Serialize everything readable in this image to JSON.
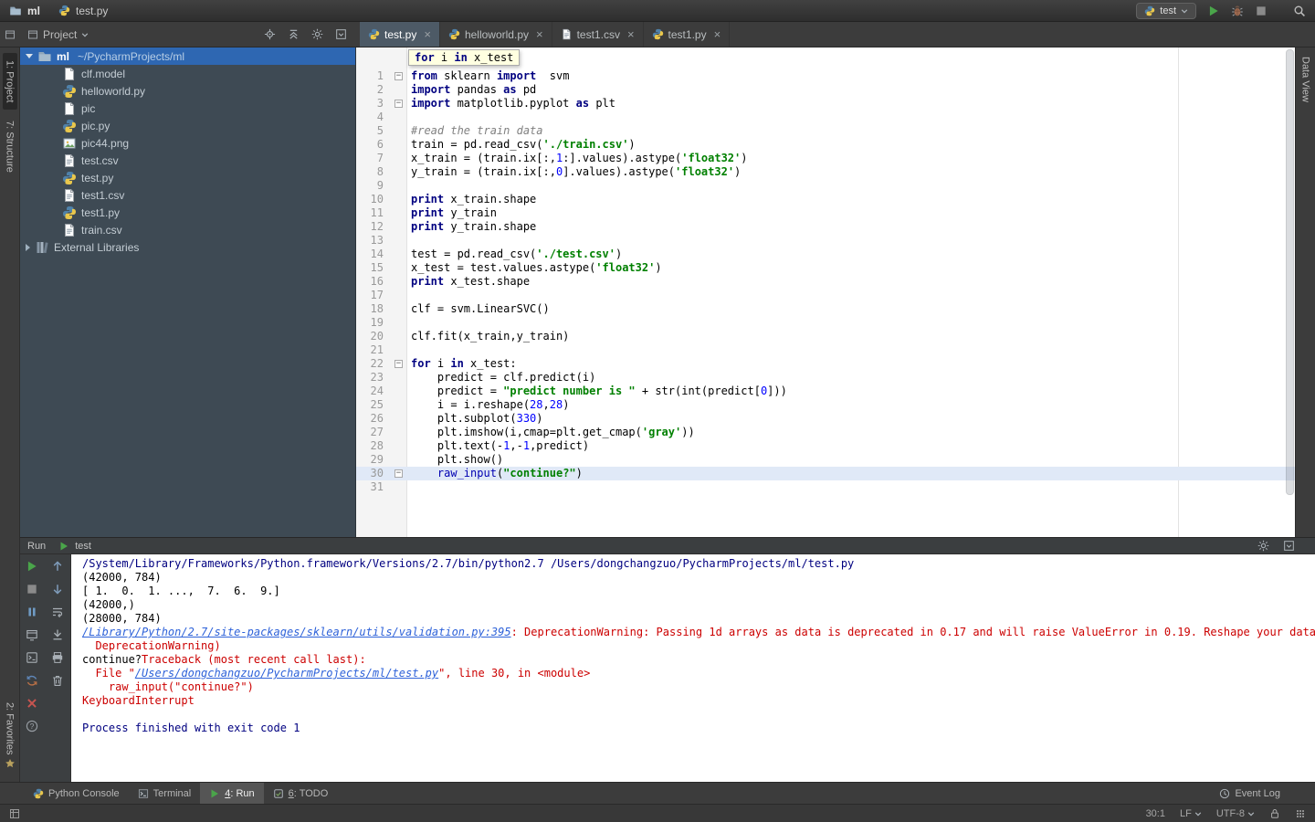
{
  "titlebar": {
    "project_label": "ml",
    "file_label": "test.py",
    "run_config_label": "test",
    "actions": [
      {
        "name": "run-button",
        "icon": "play-icon"
      },
      {
        "name": "debug-button",
        "icon": "debug-icon"
      },
      {
        "name": "stop-button",
        "icon": "stop-icon"
      },
      {
        "name": "search-everywhere-button",
        "icon": "search-icon"
      }
    ]
  },
  "tool_strips": {
    "left_top": [
      {
        "label": "1: Project",
        "active": true
      },
      {
        "label": "7: Structure",
        "active": false
      }
    ],
    "left_bottom": [
      {
        "label": "2: Favorites",
        "icon": "star-icon",
        "active": false
      }
    ],
    "right_top": [
      {
        "label": "Data View",
        "active": false
      }
    ]
  },
  "project_panel": {
    "header_title": "Project",
    "header_actions": [
      {
        "name": "locate-button",
        "icon": "locate-icon"
      },
      {
        "name": "collapse-all-button",
        "icon": "collapse-all-icon"
      },
      {
        "name": "settings-button",
        "icon": "gear-icon"
      },
      {
        "name": "hide-panel-button",
        "icon": "hide-icon"
      }
    ],
    "root_label": "ml",
    "root_path": "~/PycharmProjects/ml",
    "items": [
      {
        "label": "clf.model",
        "icon": "file-icon"
      },
      {
        "label": "helloworld.py",
        "icon": "python-file-icon"
      },
      {
        "label": "pic",
        "icon": "file-icon"
      },
      {
        "label": "pic.py",
        "icon": "python-file-icon"
      },
      {
        "label": "pic44.png",
        "icon": "image-file-icon"
      },
      {
        "label": "test.csv",
        "icon": "text-file-icon"
      },
      {
        "label": "test.py",
        "icon": "python-file-icon"
      },
      {
        "label": "test1.csv",
        "icon": "text-file-icon"
      },
      {
        "label": "test1.py",
        "icon": "python-file-icon"
      },
      {
        "label": "train.csv",
        "icon": "text-file-icon"
      }
    ],
    "external_libraries_label": "External Libraries"
  },
  "editor_tabs": [
    {
      "label": "test.py",
      "icon": "python-file-icon",
      "active": true
    },
    {
      "label": "helloworld.py",
      "icon": "python-file-icon",
      "active": false
    },
    {
      "label": "test1.csv",
      "icon": "text-file-icon",
      "active": false
    },
    {
      "label": "test1.py",
      "icon": "python-file-icon",
      "active": false
    }
  ],
  "editor": {
    "context_hint": [
      {
        "c": "k",
        "t": "for"
      },
      {
        "c": "p",
        "t": " i "
      },
      {
        "c": "k",
        "t": "in"
      },
      {
        "c": "p",
        "t": " x_test"
      }
    ],
    "fold_lines": [
      1,
      3,
      22,
      30
    ],
    "current_line": 30,
    "lines": [
      {
        "n": 1,
        "segs": [
          {
            "c": "k",
            "t": "from"
          },
          {
            "c": "p",
            "t": " sklearn "
          },
          {
            "c": "k",
            "t": "import"
          },
          {
            "c": "p",
            "t": "  svm"
          }
        ]
      },
      {
        "n": 2,
        "segs": [
          {
            "c": "k",
            "t": "import"
          },
          {
            "c": "p",
            "t": " pandas "
          },
          {
            "c": "k",
            "t": "as"
          },
          {
            "c": "p",
            "t": " pd"
          }
        ]
      },
      {
        "n": 3,
        "segs": [
          {
            "c": "k",
            "t": "import"
          },
          {
            "c": "p",
            "t": " matplotlib.pyplot "
          },
          {
            "c": "k",
            "t": "as"
          },
          {
            "c": "p",
            "t": " plt"
          }
        ]
      },
      {
        "n": 4,
        "segs": []
      },
      {
        "n": 5,
        "segs": [
          {
            "c": "c",
            "t": "#read the train data"
          }
        ]
      },
      {
        "n": 6,
        "segs": [
          {
            "c": "p",
            "t": "train = pd.read_csv("
          },
          {
            "c": "s",
            "t": "'./train.csv'"
          },
          {
            "c": "p",
            "t": ")"
          }
        ]
      },
      {
        "n": 7,
        "segs": [
          {
            "c": "p",
            "t": "x_train = (train.ix[:,"
          },
          {
            "c": "n",
            "t": "1"
          },
          {
            "c": "p",
            "t": ":].values).astype("
          },
          {
            "c": "s",
            "t": "'float32'"
          },
          {
            "c": "p",
            "t": ")"
          }
        ]
      },
      {
        "n": 8,
        "segs": [
          {
            "c": "p",
            "t": "y_train = (train.ix[:,"
          },
          {
            "c": "n",
            "t": "0"
          },
          {
            "c": "p",
            "t": "].values).astype("
          },
          {
            "c": "s",
            "t": "'float32'"
          },
          {
            "c": "p",
            "t": ")"
          }
        ]
      },
      {
        "n": 9,
        "segs": []
      },
      {
        "n": 10,
        "segs": [
          {
            "c": "k",
            "t": "print"
          },
          {
            "c": "p",
            "t": " x_train.shape"
          }
        ]
      },
      {
        "n": 11,
        "segs": [
          {
            "c": "k",
            "t": "print"
          },
          {
            "c": "p",
            "t": " y_train"
          }
        ]
      },
      {
        "n": 12,
        "segs": [
          {
            "c": "k",
            "t": "print"
          },
          {
            "c": "p",
            "t": " y_train.shape"
          }
        ]
      },
      {
        "n": 13,
        "segs": []
      },
      {
        "n": 14,
        "segs": [
          {
            "c": "p",
            "t": "test = pd.read_csv("
          },
          {
            "c": "s",
            "t": "'./test.csv'"
          },
          {
            "c": "p",
            "t": ")"
          }
        ]
      },
      {
        "n": 15,
        "segs": [
          {
            "c": "p",
            "t": "x_test = test.values.astype("
          },
          {
            "c": "s",
            "t": "'float32'"
          },
          {
            "c": "p",
            "t": ")"
          }
        ]
      },
      {
        "n": 16,
        "segs": [
          {
            "c": "k",
            "t": "print"
          },
          {
            "c": "p",
            "t": " x_test.shape"
          }
        ]
      },
      {
        "n": 17,
        "segs": []
      },
      {
        "n": 18,
        "segs": [
          {
            "c": "p",
            "t": "clf = svm.LinearSVC()"
          }
        ]
      },
      {
        "n": 19,
        "segs": []
      },
      {
        "n": 20,
        "segs": [
          {
            "c": "p",
            "t": "clf.fit(x_train,y_train)"
          }
        ]
      },
      {
        "n": 21,
        "segs": []
      },
      {
        "n": 22,
        "segs": [
          {
            "c": "k",
            "t": "for"
          },
          {
            "c": "p",
            "t": " i "
          },
          {
            "c": "k",
            "t": "in"
          },
          {
            "c": "p",
            "t": " x_test:"
          }
        ]
      },
      {
        "n": 23,
        "segs": [
          {
            "c": "p",
            "t": "    predict = clf.predict(i)"
          }
        ]
      },
      {
        "n": 24,
        "segs": [
          {
            "c": "p",
            "t": "    predict = "
          },
          {
            "c": "s",
            "t": "\"predict number is \""
          },
          {
            "c": "p",
            "t": " + str(int(predict["
          },
          {
            "c": "n",
            "t": "0"
          },
          {
            "c": "p",
            "t": "]))"
          }
        ]
      },
      {
        "n": 25,
        "segs": [
          {
            "c": "p",
            "t": "    i = i.reshape("
          },
          {
            "c": "n",
            "t": "28"
          },
          {
            "c": "p",
            "t": ","
          },
          {
            "c": "n",
            "t": "28"
          },
          {
            "c": "p",
            "t": ")"
          }
        ]
      },
      {
        "n": 26,
        "segs": [
          {
            "c": "p",
            "t": "    plt.subplot("
          },
          {
            "c": "n",
            "t": "330"
          },
          {
            "c": "p",
            "t": ")"
          }
        ]
      },
      {
        "n": 27,
        "segs": [
          {
            "c": "p",
            "t": "    plt.imshow(i,cmap=plt.get_cmap("
          },
          {
            "c": "s",
            "t": "'gray'"
          },
          {
            "c": "p",
            "t": "))"
          }
        ]
      },
      {
        "n": 28,
        "segs": [
          {
            "c": "p",
            "t": "    plt.text(-"
          },
          {
            "c": "n",
            "t": "1"
          },
          {
            "c": "p",
            "t": ",-"
          },
          {
            "c": "n",
            "t": "1"
          },
          {
            "c": "p",
            "t": ",predict)"
          }
        ]
      },
      {
        "n": 29,
        "segs": [
          {
            "c": "p",
            "t": "    plt.show()"
          }
        ]
      },
      {
        "n": 30,
        "segs": [
          {
            "c": "p",
            "t": "    "
          },
          {
            "c": "b",
            "t": "raw_input"
          },
          {
            "c": "p",
            "t": "("
          },
          {
            "c": "s",
            "t": "\"continue?\""
          },
          {
            "c": "p",
            "t": ")"
          }
        ]
      },
      {
        "n": 31,
        "segs": []
      }
    ]
  },
  "run_panel": {
    "title": "Run",
    "config_label": "test",
    "header_actions": [
      {
        "name": "settings-button",
        "icon": "gear-icon"
      },
      {
        "name": "hide-panel-button",
        "icon": "hide-icon"
      }
    ],
    "toolbar_main": [
      {
        "name": "rerun-button",
        "icon": "play-icon"
      },
      {
        "name": "stop-button",
        "icon": "stop-icon"
      },
      {
        "name": "pause-output-button",
        "icon": "pause-icon"
      },
      {
        "name": "restore-layout-button",
        "icon": "restore-layout-icon"
      },
      {
        "name": "show-console-button",
        "icon": "console-icon"
      },
      {
        "name": "rerun-failed-button",
        "icon": "refresh-icon"
      },
      {
        "name": "close-button",
        "icon": "close-icon"
      },
      {
        "name": "help-button",
        "icon": "help-icon"
      }
    ],
    "toolbar_secondary": [
      {
        "name": "up-stack-trace-button",
        "icon": "up-icon"
      },
      {
        "name": "down-stack-trace-button",
        "icon": "down-icon"
      },
      {
        "name": "soft-wrap-button",
        "icon": "soft-wrap-icon"
      },
      {
        "name": "scroll-to-end-button",
        "icon": "scroll-end-icon"
      },
      {
        "name": "print-button",
        "icon": "print-icon"
      },
      {
        "name": "clear-all-button",
        "icon": "trash-icon"
      }
    ],
    "console_lines": [
      {
        "segs": [
          {
            "c": "sys",
            "t": "/System/Library/Frameworks/Python.framework/Versions/2.7/bin/python2.7 /Users/dongchangzuo/PycharmProjects/ml/test.py"
          }
        ]
      },
      {
        "segs": [
          {
            "c": "out",
            "t": "(42000, 784)"
          }
        ]
      },
      {
        "segs": [
          {
            "c": "out",
            "t": "[ 1.  0.  1. ...,  7.  6.  9.]"
          }
        ]
      },
      {
        "segs": [
          {
            "c": "out",
            "t": "(42000,)"
          }
        ]
      },
      {
        "segs": [
          {
            "c": "out",
            "t": "(28000, 784)"
          }
        ]
      },
      {
        "segs": [
          {
            "c": "link",
            "t": "/Library/Python/2.7/site-packages/sklearn/utils/validation.py:395"
          },
          {
            "c": "err",
            "t": ": DeprecationWarning: Passing 1d arrays as data is deprecated in 0.17 and will raise ValueError in 0.19. Reshape your data ei"
          }
        ]
      },
      {
        "segs": [
          {
            "c": "err",
            "t": "  DeprecationWarning)"
          }
        ]
      },
      {
        "segs": [
          {
            "c": "out",
            "t": "continue?"
          },
          {
            "c": "err",
            "t": "Traceback (most recent call last):"
          }
        ]
      },
      {
        "segs": [
          {
            "c": "err",
            "t": "  File \""
          },
          {
            "c": "link",
            "t": "/Users/dongchangzuo/PycharmProjects/ml/test.py"
          },
          {
            "c": "err",
            "t": "\", line 30, in <module>"
          }
        ]
      },
      {
        "segs": [
          {
            "c": "err",
            "t": "    raw_input(\"continue?\")"
          }
        ]
      },
      {
        "segs": [
          {
            "c": "err",
            "t": "KeyboardInterrupt"
          }
        ]
      },
      {
        "segs": [
          {
            "c": "out",
            "t": ""
          }
        ]
      },
      {
        "segs": [
          {
            "c": "sys",
            "t": "Process finished with exit code 1"
          }
        ]
      }
    ]
  },
  "toolwindow_bar": {
    "left": [
      {
        "icon": "python-file-icon",
        "mnemonic": null,
        "label": "Python Console",
        "active": false
      },
      {
        "icon": "terminal-icon",
        "mnemonic": null,
        "label": "Terminal",
        "active": false
      },
      {
        "icon": "play-icon",
        "mnemonic": "4",
        "label": "Run",
        "active": true
      },
      {
        "icon": "todo-icon",
        "mnemonic": "6",
        "label": "TODO",
        "active": false
      }
    ],
    "right": [
      {
        "icon": "event-log-icon",
        "mnemonic": null,
        "label": "Event Log",
        "active": false
      }
    ]
  },
  "status_bar": {
    "caret_position": "30:1",
    "line_separator": "LF",
    "encoding": "UTF-8"
  },
  "colors": {
    "selection_blue": "#2e67b2",
    "keyword": "#000080",
    "string": "#008000",
    "number": "#0000ff",
    "comment": "#808080",
    "error_red": "#cc0000",
    "link_blue": "#2e62d9",
    "run_green": "#4aa54a"
  }
}
